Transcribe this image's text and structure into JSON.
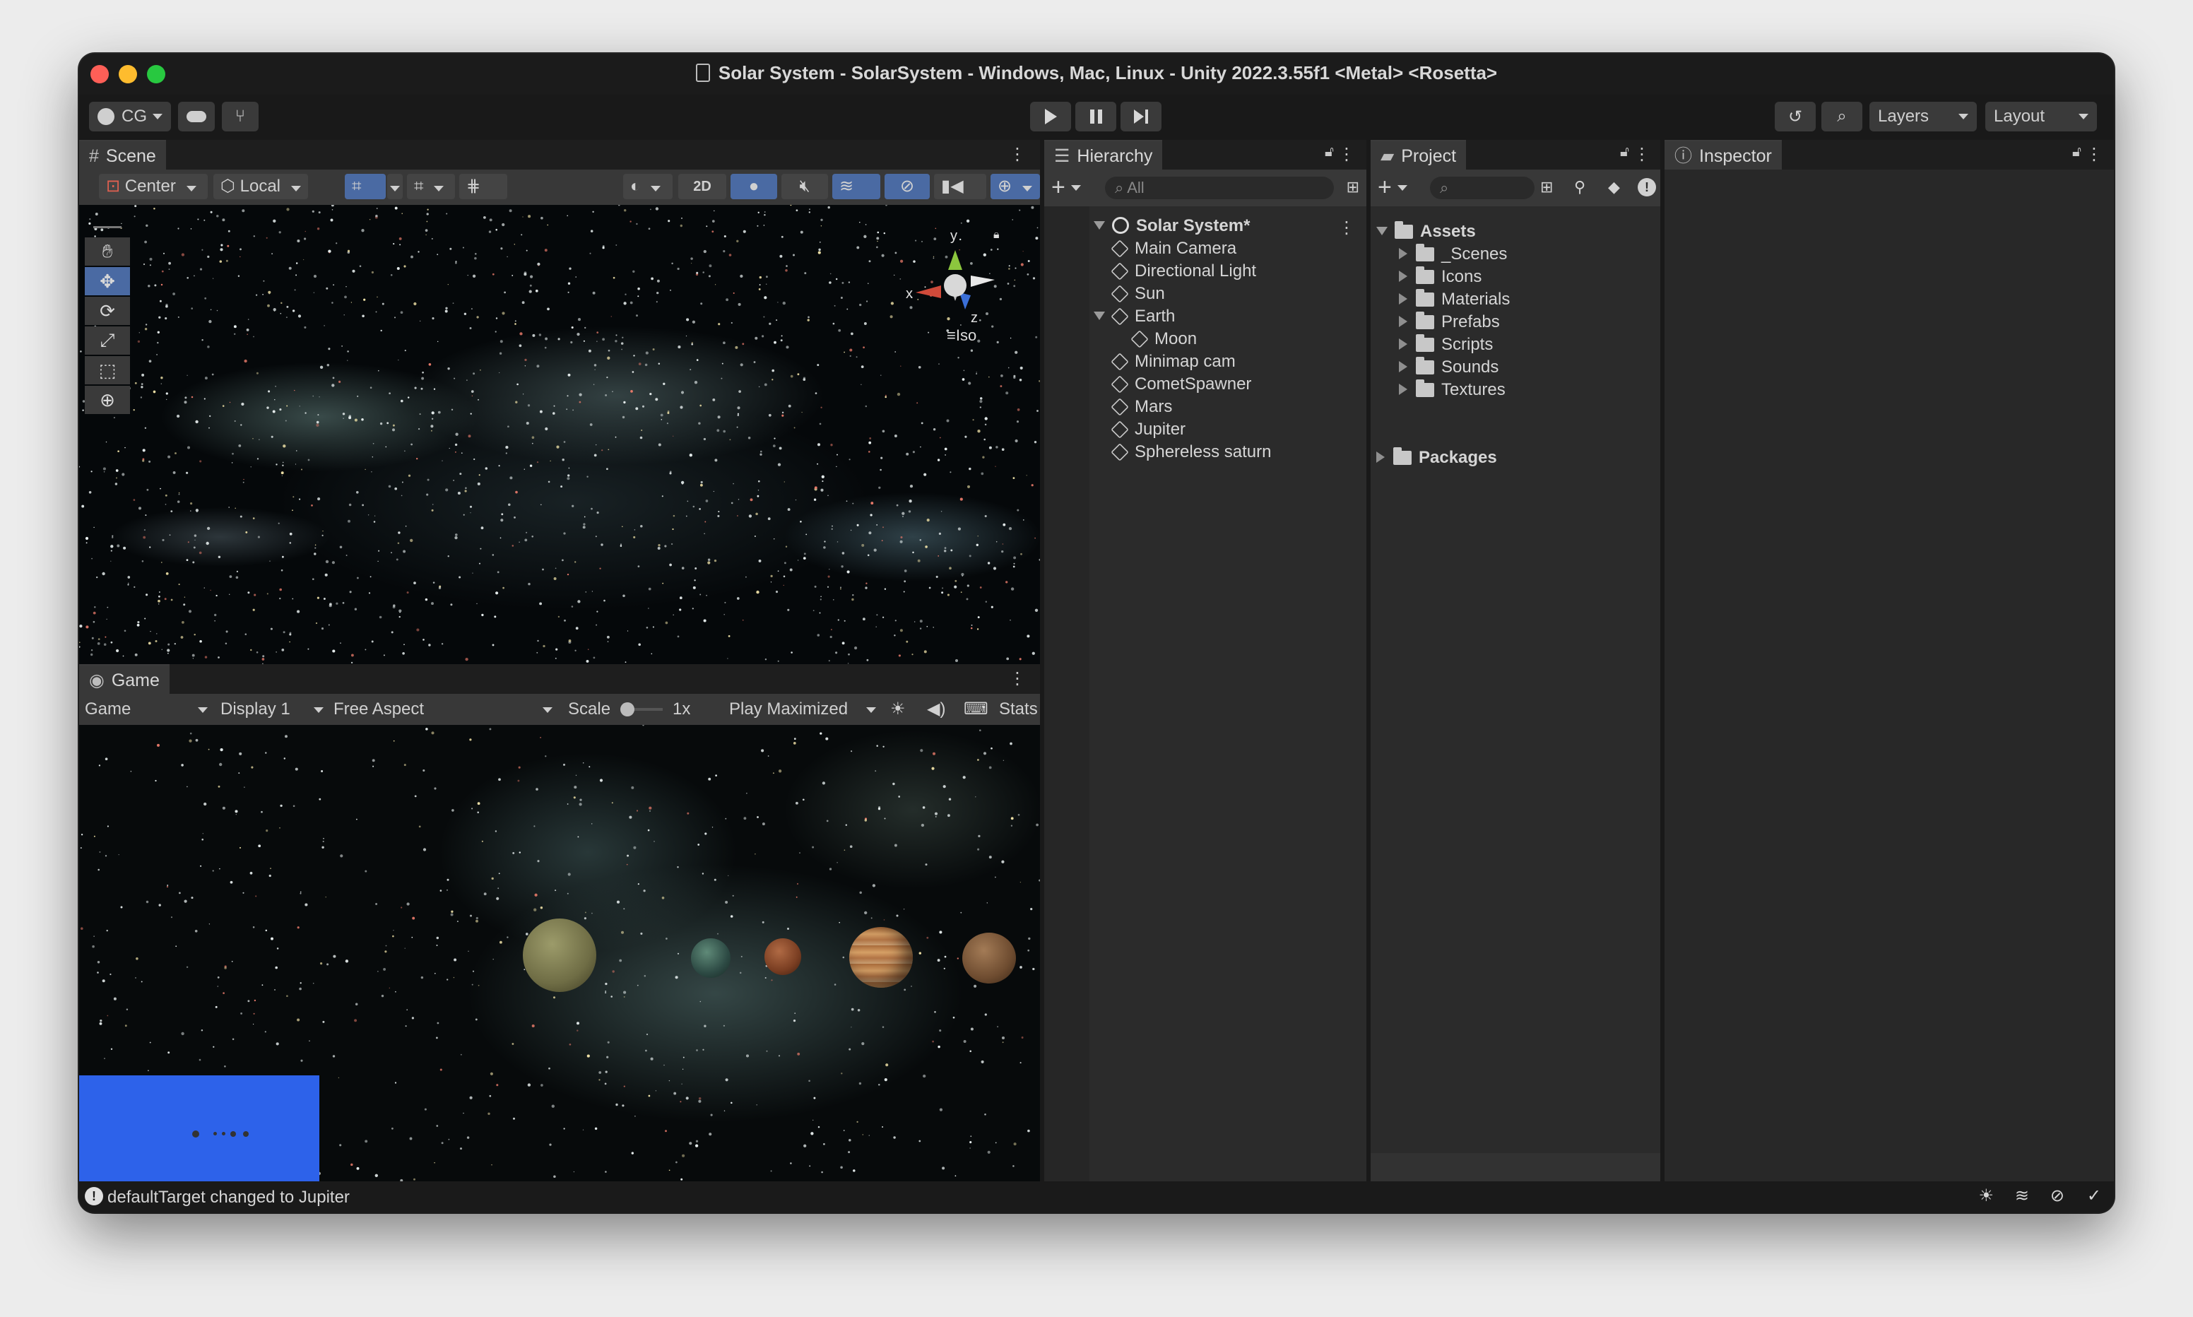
{
  "window": {
    "title": "Solar System - SolarSystem - Windows, Mac, Linux - Unity 2022.3.55f1 <Metal> <Rosetta>"
  },
  "toolbar": {
    "account": "CG",
    "layers": "Layers",
    "layout": "Layout",
    "icons": [
      "account-icon",
      "cloud-icon",
      "collab-icon",
      "play-icon",
      "pause-icon",
      "step-icon",
      "history-icon",
      "search-icon"
    ]
  },
  "scene": {
    "tab": "Scene",
    "pivot": "Center",
    "space": "Local",
    "mode_2d": "2D",
    "gizmo": {
      "y": "y",
      "x": "x",
      "z": "z",
      "projection": "Iso"
    }
  },
  "game": {
    "tab": "Game",
    "view": "Game",
    "display": "Display 1",
    "aspect": "Free Aspect",
    "scale_label": "Scale",
    "scale_value": "1x",
    "play_mode": "Play Maximized",
    "stats": "Stats"
  },
  "hierarchy": {
    "tab": "Hierarchy",
    "search_placeholder": "All",
    "root": "Solar System*",
    "items": [
      {
        "label": "Main Camera",
        "depth": 1
      },
      {
        "label": "Directional Light",
        "depth": 1
      },
      {
        "label": "Sun",
        "depth": 1
      },
      {
        "label": "Earth",
        "depth": 1,
        "expanded": true
      },
      {
        "label": "Moon",
        "depth": 2
      },
      {
        "label": "Minimap cam",
        "depth": 1
      },
      {
        "label": "CometSpawner",
        "depth": 1
      },
      {
        "label": "Mars",
        "depth": 1
      },
      {
        "label": "Jupiter",
        "depth": 1
      },
      {
        "label": "Sphereless saturn",
        "depth": 1
      }
    ]
  },
  "project": {
    "tab": "Project",
    "assets_label": "Assets",
    "folders": [
      "_Scenes",
      "Icons",
      "Materials",
      "Prefabs",
      "Scripts",
      "Sounds",
      "Textures"
    ],
    "packages_label": "Packages"
  },
  "inspector": {
    "tab": "Inspector"
  },
  "status": {
    "message": "defaultTarget changed to Jupiter"
  },
  "colors": {
    "accent": "#4a6aa3",
    "minimap": "#2d62ea",
    "window_bg": "#191919",
    "panel_bg": "#282828"
  }
}
